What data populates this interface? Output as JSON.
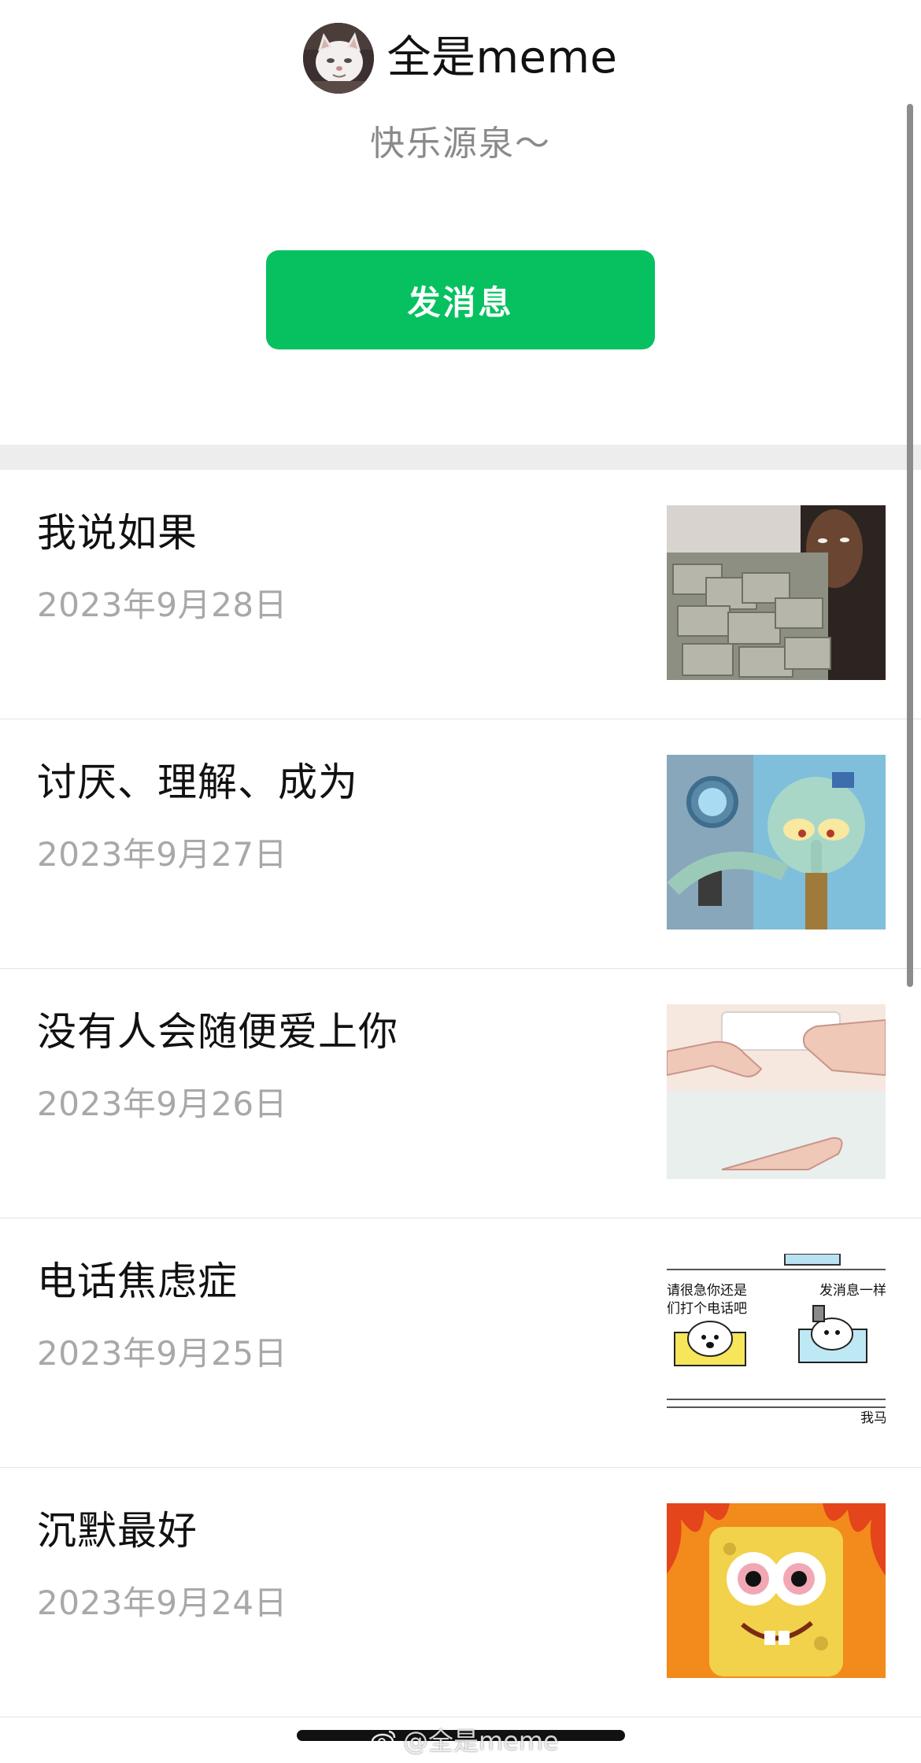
{
  "header": {
    "account_name": "全是meme",
    "subtitle": "快乐源泉～",
    "message_button_label": "发消息",
    "avatar_icon": "cat-avatar"
  },
  "colors": {
    "accent_green": "#07c160",
    "title_text": "#111111",
    "date_text": "#a8a8a8",
    "divider_band": "#ededed"
  },
  "articles": [
    {
      "title": "我说如果",
      "date": "2023年9月28日",
      "thumbnail_icon": "money-stack-meme-image"
    },
    {
      "title": "讨厌、理解、成为",
      "date": "2023年9月27日",
      "thumbnail_icon": "squidward-meme-image"
    },
    {
      "title": "没有人会随便爱上你",
      "date": "2023年9月26日",
      "thumbnail_icon": "hands-meme-image"
    },
    {
      "title": "电话焦虑症",
      "date": "2023年9月25日",
      "thumbnail_icon": "phone-anxiety-comic-image",
      "thumbnail_text": [
        "请很急你还是",
        "们打个电话吧",
        "发消息一样",
        "我马"
      ]
    },
    {
      "title": "沉默最好",
      "date": "2023年9月24日",
      "thumbnail_icon": "spongebob-fire-meme-image"
    }
  ],
  "watermark": {
    "text": "@全是meme",
    "icon": "weibo-icon"
  }
}
